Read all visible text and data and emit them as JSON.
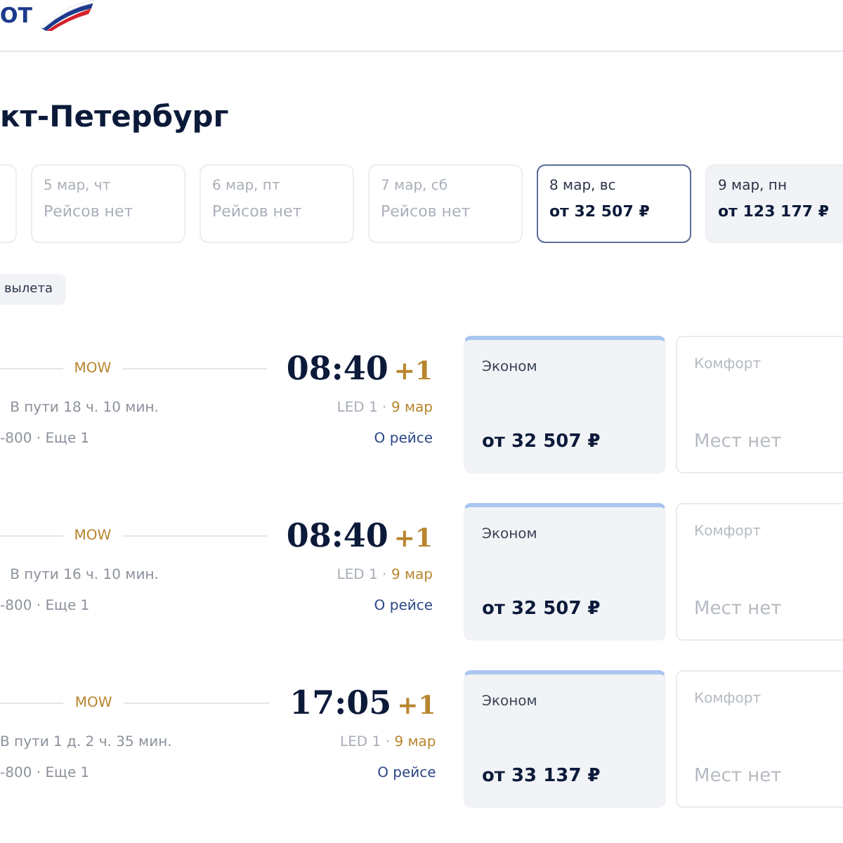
{
  "header": {
    "logo_text": "ОТ"
  },
  "title": "кт-Петербург",
  "dates": [
    {
      "date": "5 мар, чт",
      "info": "Рейсов нет",
      "available": false,
      "selected": false
    },
    {
      "date": "6 мар, пт",
      "info": "Рейсов нет",
      "available": false,
      "selected": false
    },
    {
      "date": "7 мар, сб",
      "info": "Рейсов нет",
      "available": false,
      "selected": false
    },
    {
      "date": "8 мар, вс",
      "info": "от 32 507 ₽",
      "available": true,
      "selected": true
    },
    {
      "date": "9 мар, пн",
      "info": "от 123 177 ₽",
      "available": true,
      "selected": false
    }
  ],
  "filter_chip": "вылета",
  "flights": [
    {
      "transfer": "MOW",
      "time": "08:40",
      "day_shift": "+1",
      "duration": "В пути 18 ч. 10 мин.",
      "airport": "LED 1 ·",
      "arrival_date": "9 мар",
      "aircraft": "-800 · Еще 1",
      "details_link": "О рейсе",
      "fares": [
        {
          "class": "Эконом",
          "price": "от 32 507 ₽",
          "available": true
        },
        {
          "class": "Комфорт",
          "price": "Мест нет",
          "available": false
        }
      ]
    },
    {
      "transfer": "MOW",
      "time": "08:40",
      "day_shift": "+1",
      "duration": "В пути 16 ч. 10 мин.",
      "airport": "LED 1 ·",
      "arrival_date": "9 мар",
      "aircraft": "-800 · Еще 1",
      "details_link": "О рейсе",
      "fares": [
        {
          "class": "Эконом",
          "price": "от 32 507 ₽",
          "available": true
        },
        {
          "class": "Комфорт",
          "price": "Мест нет",
          "available": false
        }
      ]
    },
    {
      "transfer": "MOW",
      "time": "17:05",
      "day_shift": "+1",
      "duration": "В пути 1 д. 2 ч. 35 мин.",
      "airport": "LED 1 ·",
      "arrival_date": "9 мар",
      "aircraft": "-800 · Еще 1",
      "details_link": "О рейсе",
      "fares": [
        {
          "class": "Эконом",
          "price": "от 33 137 ₽",
          "available": true
        },
        {
          "class": "Комфорт",
          "price": "Мест нет",
          "available": false
        }
      ]
    }
  ]
}
